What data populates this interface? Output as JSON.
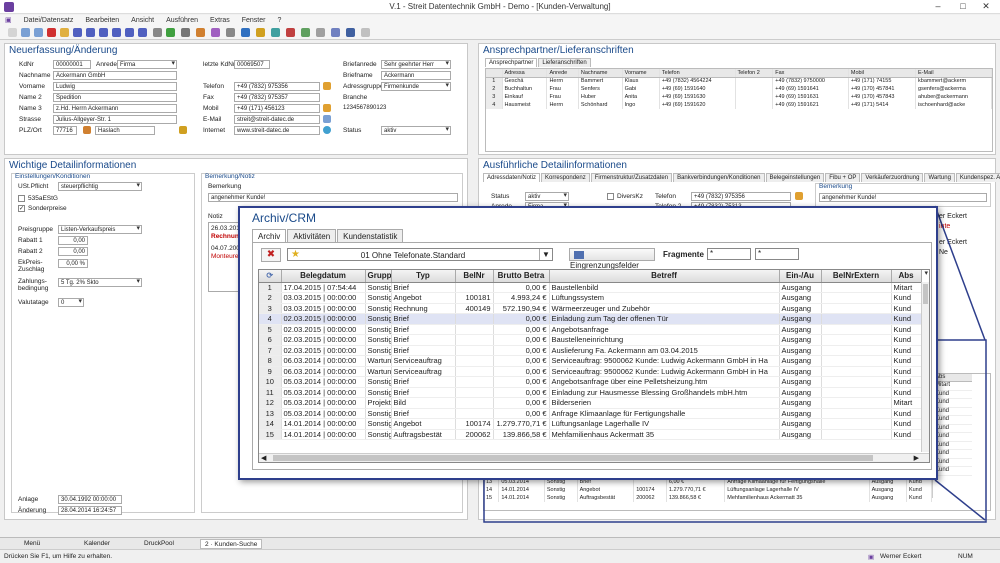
{
  "window": {
    "title": "V.1 - Streit Datentechnik GmbH - Demo - [Kunden-Verwaltung]"
  },
  "menu": [
    "Datei/Datensatz",
    "Bearbeiten",
    "Ansicht",
    "Ausführen",
    "Extras",
    "Fenster",
    "?"
  ],
  "neuerfassung": {
    "title": "Neuerfassung/Änderung",
    "kdnr_label": "KdNr",
    "kdnr": "00000001",
    "anrede_label": "Anrede",
    "anrede": "Firma",
    "nachname_label": "Nachname",
    "nachname": "Ackermann GmbH",
    "vorname_label": "Vorname",
    "vorname": "Ludwig",
    "name2_label": "Name 2",
    "name2": "Spedition",
    "name3_label": "Name 3",
    "name3": "z.Hd. Herrn Ackermann",
    "strasse_label": "Strasse",
    "strasse": "Julius-Allgeyer-Str. 1",
    "plz_label": "PLZ/Ort",
    "plz": "77716",
    "ort": "Haslach",
    "letzte_kdnr_label": "letzte KdNr",
    "letzte_kdnr": "00069507",
    "telefon_label": "Telefon",
    "telefon": "+49 (7832) 975356",
    "fax_label": "Fax",
    "fax": "+49 (7832) 975357",
    "mobil_label": "Mobil",
    "mobil": "+49 (171) 456123",
    "email_label": "E-Mail",
    "email": "streit@streit-datec.de",
    "internet_label": "Internet",
    "internet": "www.streit-datec.de",
    "briefanrede_label": "Briefanrede",
    "briefanrede": "Sehr geehrter Herr",
    "briefname_label": "Briefname",
    "briefname": "Ackermann",
    "adressgruppe_label": "Adressgruppe",
    "adressgruppe": "Firmenkunde",
    "branche_label": "Branche",
    "branche_code": "1234567890123",
    "status_label": "Status",
    "status": "aktiv"
  },
  "ansprech": {
    "title": "Ansprechpartner/Lieferanschriften",
    "tabs": [
      "Ansprechpartner",
      "Lieferanschriften"
    ],
    "columns": [
      "Adressa",
      "Anrede",
      "Nachname",
      "Vorname",
      "Telefon",
      "Telefon 2",
      "Fax",
      "Mobil",
      "E-Mail"
    ],
    "rows": [
      [
        "1",
        "Geschä",
        "Herrn",
        "Bammert",
        "Klaus",
        "+49 (7832) 4564224",
        "",
        "+49 (7832) 9750000",
        "+49 (171) 74155",
        "kbammert@ackerm"
      ],
      [
        "2",
        "Buchhaltun",
        "Frau",
        "Senfers",
        "Gabi",
        "+49 (69) 1591640",
        "",
        "+49 (69) 1591641",
        "+49 (170) 457841",
        "gsenfers@ackerma"
      ],
      [
        "3",
        "Einkauf",
        "Frau",
        "Huber",
        "Anita",
        "+49 (69) 1591630",
        "",
        "+49 (69) 1591631",
        "+49 (170) 457843",
        "ahuber@ackermann"
      ],
      [
        "4",
        "Hausmeist",
        "Herrn",
        "Schönhard",
        "Ingo",
        "+49 (69) 1591620",
        "",
        "+49 (69) 1591621",
        "+49 (171) 5414",
        "ischoenhard@acke"
      ]
    ]
  },
  "wichtige": {
    "title": "Wichtige Detailinformationen",
    "group_title": "Einstellungen/Konditionen",
    "ustpflicht_label": "USt.Pflicht",
    "ustpflicht": "steuerpflichtig",
    "check_535": "535aEStG",
    "check_sonder": "Sonderpreise",
    "preisgruppe_label": "Preisgruppe",
    "preisgruppe": "Listen-Verkaufspreis",
    "rabatt1_label": "Rabatt 1",
    "rabatt1": "0,00",
    "rabatt2_label": "Rabatt 2",
    "rabatt2": "0,00",
    "ekpreis_label": "EkPreis-Zuschlag",
    "ekpreis": "0,00 %",
    "zahlung_label": "Zahlungs-bedingung",
    "zahlung": "5 Tg. 2% Skto",
    "valuta_label": "Valutatage",
    "valuta": "0",
    "anlage_label": "Anlage",
    "anlage": "30.04.1992 00:00:00",
    "aenderung_label": "Änderung",
    "aenderung": "28.04.2014 16:24:57",
    "bemerkung_group": "Bemerkung/Notiz",
    "bemerkung_label": "Bemerkung",
    "bemerkung": "angenehmer Kunde!",
    "notiz_label": "Notiz",
    "notiz_line1": "26.03.2013",
    "notiz_line2": "Rechnungen",
    "notiz_line3": "04.07.2008",
    "notiz_line4": "Monteure m"
  },
  "ausfuehrlich": {
    "title": "Ausführliche Detailinformationen",
    "tabs": [
      "Adressdaten/Notiz",
      "Korrespondenz",
      "Firmenstruktur/Zusatzdaten",
      "Bankverbindungen/Konditionen",
      "Belegeinstellungen",
      "Fibu + OP",
      "Verkäuferzuordnung",
      "Wartung",
      "Kundenspez. Artikel-Nr"
    ],
    "status_label": "Status",
    "status": "aktiv",
    "diverskz": "DiversKz",
    "anrede_label": "Anrede",
    "anrede": "Firma",
    "telefon_label": "Telefon",
    "telefon": "+49 (7832) 975356",
    "telefon2_label": "Telefon 2",
    "telefon2": "+49 (7832) 75313",
    "bemerkung_label": "Bemerkung",
    "bemerkung": "angenehmer Kunde!",
    "right_peek": [
      "er Eckert",
      "inte",
      "er Eckert",
      "Ne"
    ],
    "mini_header": [
      "Abs"
    ],
    "mini_col": [
      "Mitart",
      "Kund",
      "Kund",
      "Kund",
      "Kund",
      "Kund",
      "Kund",
      "Kund",
      "Kund",
      "Kund",
      "Kund"
    ],
    "bottom_rows": [
      [
        "13",
        "05.03.2014",
        "Sonstig",
        "Brief",
        "",
        "6,00 €",
        "Anfrage Klimaanlage für Fertigungshalle",
        "Ausgang",
        "Kund"
      ],
      [
        "14",
        "14.01.2014",
        "Sonstig",
        "Angebot",
        "100174",
        "1.279.770,71 €",
        "Lüftungsanlage Lagerhalle IV",
        "Ausgang",
        "Kund"
      ],
      [
        "15",
        "14.01.2014",
        "Sonstig",
        "Auftragsbestät",
        "200062",
        "139.866,58 €",
        "Mehfamilienhaus Ackermatt 35",
        "Ausgang",
        "Kund"
      ]
    ]
  },
  "crm": {
    "title": "Archiv/CRM",
    "tabs": [
      "Archiv",
      "Aktivitäten",
      "Kundenstatistik"
    ],
    "filter": "01 Ohne Telefonate.Standard",
    "eingrenz_button": "Eingrenzungsfelder",
    "fragmente_label": "Fragmente",
    "fragment1": "*",
    "fragment2": "*",
    "columns": [
      "",
      "Belegdatum",
      "Grupp",
      "Typ",
      "BelNr",
      "Brutto Betra",
      "Betreff",
      "Ein-/Au",
      "BelNrExtern",
      "Abs"
    ],
    "rows": [
      [
        "1",
        "17.04.2015 | 07:54:44",
        "Sonstig",
        "Brief",
        "",
        "0,00 €",
        "Baustellenbild",
        "Ausgang",
        "",
        "Mitart"
      ],
      [
        "2",
        "03.03.2015 | 00:00:00",
        "Sonstig",
        "Angebot",
        "100181",
        "4.993,24 €",
        "Lüftungssystem",
        "Ausgang",
        "",
        "Kund"
      ],
      [
        "3",
        "03.03.2015 | 00:00:00",
        "Sonstig",
        "Rechnung",
        "400149",
        "572.190,94 €",
        "Wärmeerzeuger und Zubehör",
        "Ausgang",
        "",
        "Kund"
      ],
      [
        "4",
        "02.03.2015 | 00:00:00",
        "Sonstig",
        "Brief",
        "",
        "0,00 €",
        "Einladung zum Tag der offenen Tür",
        "Ausgang",
        "",
        "Kund"
      ],
      [
        "5",
        "02.03.2015 | 00:00:00",
        "Sonstig",
        "Brief",
        "",
        "0,00 €",
        "Angebotsanfrage",
        "Ausgang",
        "",
        "Kund"
      ],
      [
        "6",
        "02.03.2015 | 00:00:00",
        "Sonstig",
        "Brief",
        "",
        "0,00 €",
        "Baustelleneinrichtung",
        "Ausgang",
        "",
        "Kund"
      ],
      [
        "7",
        "02.03.2015 | 00:00:00",
        "Sonstig",
        "Brief",
        "",
        "0,00 €",
        "Auslieferung Fa. Ackermann am 03.04.2015",
        "Ausgang",
        "",
        "Kund"
      ],
      [
        "8",
        "06.03.2014 | 00:00:00",
        "Wartun",
        "Serviceauftrag",
        "",
        "0,00 €",
        "Serviceauftrag: 9500062  Kunde: Ludwig Ackermann GmbH in Ha",
        "Ausgang",
        "",
        "Kund"
      ],
      [
        "9",
        "06.03.2014 | 00:00:00",
        "Wartun",
        "Serviceauftrag",
        "",
        "0,00 €",
        "Serviceauftrag: 9500062  Kunde: Ludwig Ackermann GmbH in Ha",
        "Ausgang",
        "",
        "Kund"
      ],
      [
        "10",
        "05.03.2014 | 00:00:00",
        "Sonstig",
        "Brief",
        "",
        "0,00 €",
        "Angebotsanfrage über eine Pelletsheizung.htm",
        "Ausgang",
        "",
        "Kund"
      ],
      [
        "11",
        "05.03.2014 | 00:00:00",
        "Sonstig",
        "Brief",
        "",
        "0,00 €",
        "Einladung zur Hausmesse   Blessing Großhandels mbH.htm",
        "Ausgang",
        "",
        "Kund"
      ],
      [
        "12",
        "05.03.2014 | 00:00:00",
        "Projekt",
        "Bild",
        "",
        "0,00 €",
        "Bilderserien",
        "Ausgang",
        "",
        "Mitart"
      ],
      [
        "13",
        "05.03.2014 | 00:00:00",
        "Sonstig",
        "Brief",
        "",
        "0,00 €",
        "Anfrage Klimaanlage für Fertigungshalle",
        "Ausgang",
        "",
        "Kund"
      ],
      [
        "14",
        "14.01.2014 | 00:00:00",
        "Sonstig",
        "Angebot",
        "100174",
        "1.279.770,71 €",
        "Lüftungsanlage Lagerhalle IV",
        "Ausgang",
        "",
        "Kund"
      ],
      [
        "15",
        "14.01.2014 | 00:00:00",
        "Sonstig",
        "Auftragsbestät",
        "200062",
        "139.866,58 €",
        "Mehfamilienhaus Ackermatt 35",
        "Ausgang",
        "",
        "Kund"
      ]
    ],
    "selected_row": 4
  },
  "taskbar": [
    "Menü",
    "Kalender",
    "DruckPool",
    "2 · Kunden-Suche"
  ],
  "status": {
    "hint": "Drücken Sie F1, um Hilfe zu erhalten.",
    "user": "Werner Eckert",
    "num": "NUM"
  },
  "colors": {
    "accent": "#2e3f8c",
    "title_blue": "#1a4a8a",
    "selection": "#dfe3f4",
    "notiz_red": "#c00000"
  }
}
